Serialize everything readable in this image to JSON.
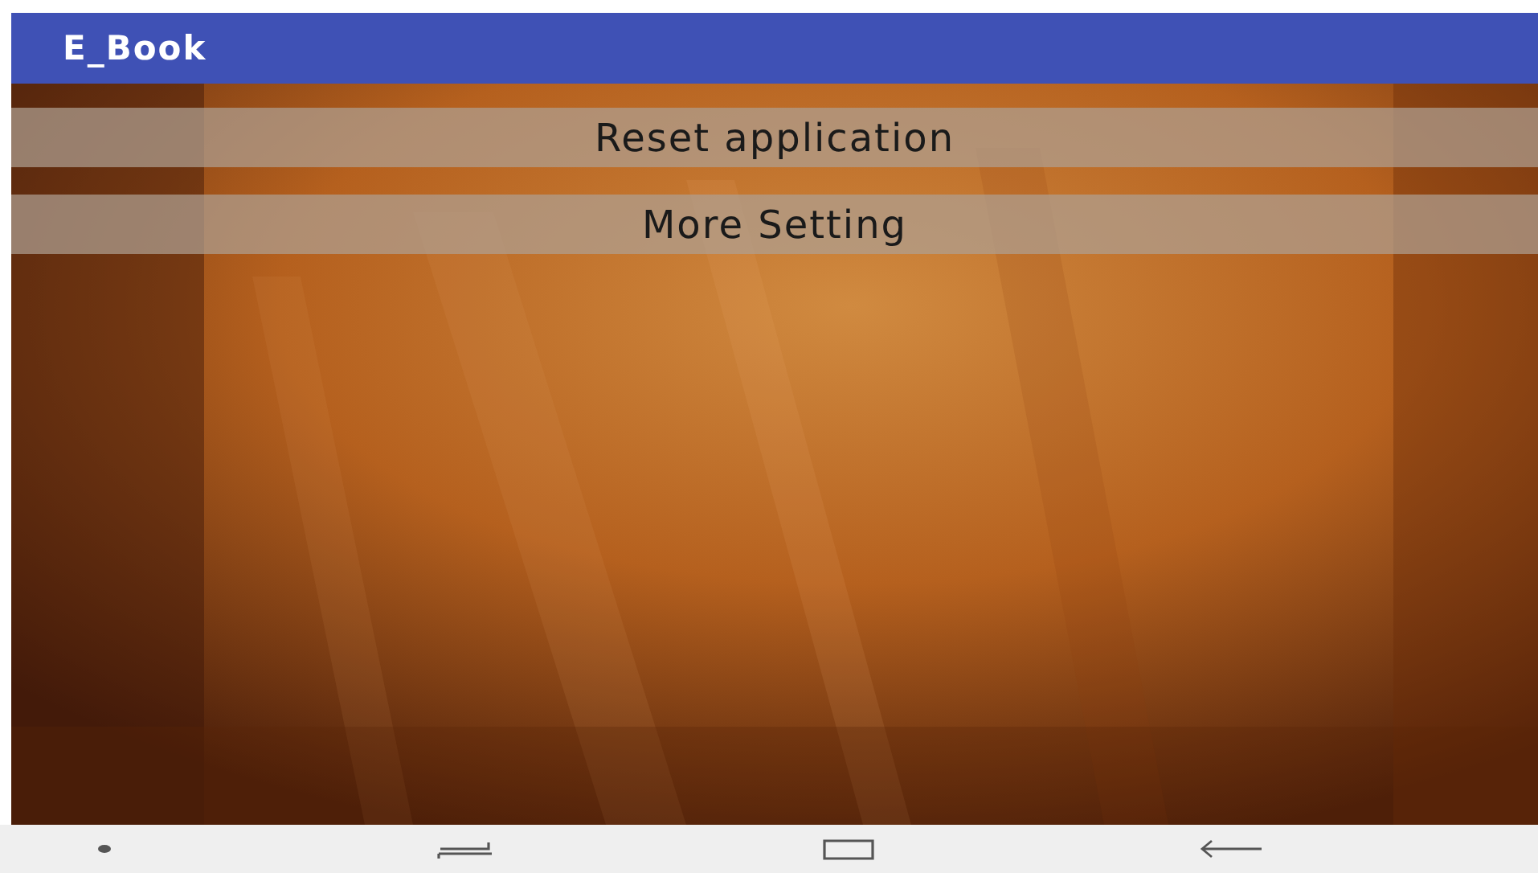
{
  "app_bar": {
    "title": "E_Book"
  },
  "buttons": [
    {
      "label": "Reset application"
    },
    {
      "label": "More Setting"
    }
  ],
  "nav_bar": {
    "items": [
      {
        "kind": "dot"
      },
      {
        "kind": "recents"
      },
      {
        "kind": "home"
      },
      {
        "kind": "back"
      }
    ]
  }
}
